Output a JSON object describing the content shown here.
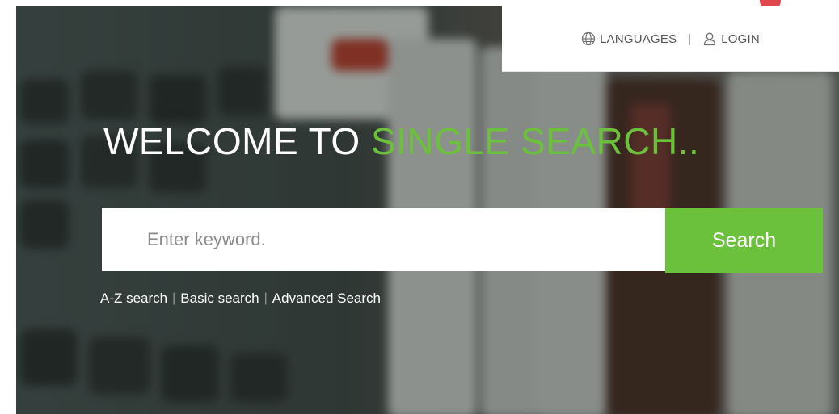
{
  "topbar": {
    "languages_label": "LANGUAGES",
    "separator": "|",
    "login_label": "LOGIN"
  },
  "hero": {
    "welcome_prefix": "WELCOME TO ",
    "welcome_accent": "SINGLE SEARCH.."
  },
  "search": {
    "placeholder": "Enter keyword.",
    "button_label": "Search"
  },
  "search_links": {
    "az": "A-Z search",
    "basic": "Basic search",
    "advanced": "Advanced Search",
    "divider": "|"
  },
  "colors": {
    "accent": "#6cc13c",
    "notification": "#e0484e"
  },
  "icons": {
    "languages": "globe-icon",
    "login": "user-icon"
  }
}
